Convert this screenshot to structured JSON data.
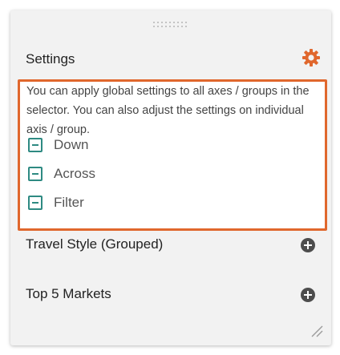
{
  "settings": {
    "title": "Settings",
    "icon": "gear-icon",
    "accent_color": "#e0672d",
    "description": "You can apply global settings to all axes / groups in the selector. You can also adjust the settings on individual axis / group.",
    "options": [
      {
        "label": "Down",
        "icon": "minus-square-icon"
      },
      {
        "label": "Across",
        "icon": "minus-square-icon"
      },
      {
        "label": "Filter",
        "icon": "minus-square-icon"
      }
    ],
    "toggle_color": "#2e8a82"
  },
  "sections": [
    {
      "label": "Travel Style (Grouped)",
      "icon": "plus-circle-icon"
    },
    {
      "label": "Top 5 Markets",
      "icon": "plus-circle-icon"
    }
  ]
}
